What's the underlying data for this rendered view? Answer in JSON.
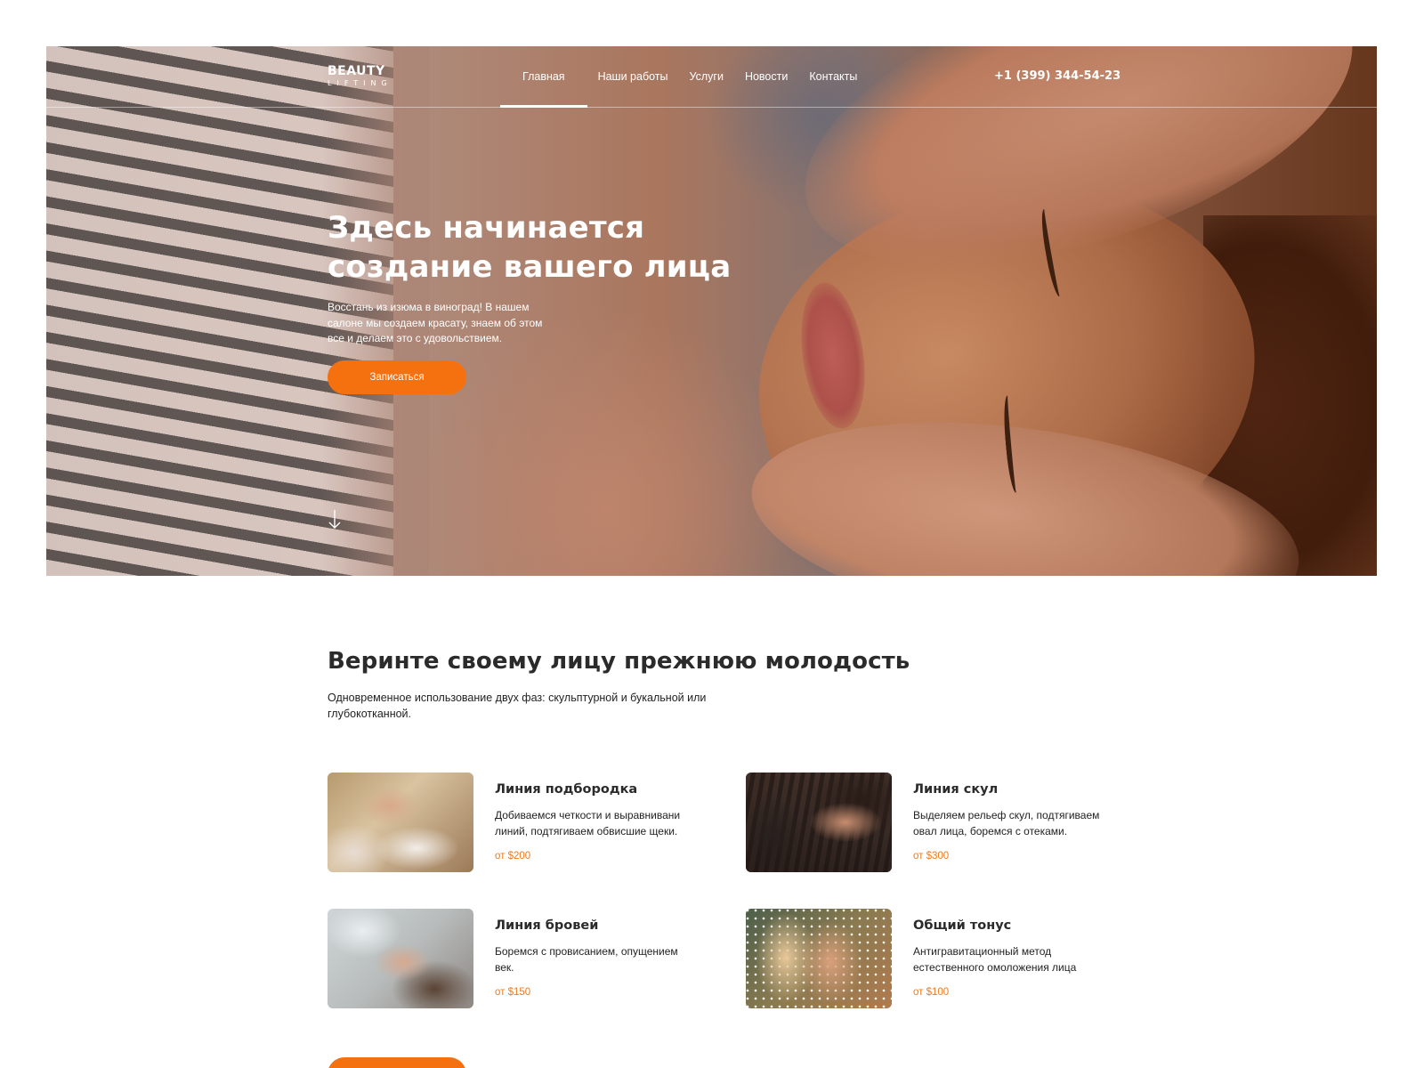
{
  "brand": {
    "name": "BEAUTY",
    "sub": "LIFTING"
  },
  "nav": {
    "items": [
      {
        "label": "Главная",
        "active": true
      },
      {
        "label": "Наши работы",
        "active": false
      },
      {
        "label": "Услуги",
        "active": false
      },
      {
        "label": "Новости",
        "active": false
      },
      {
        "label": "Контакты",
        "active": false
      }
    ],
    "phone": "+1 (399) 344-54-23"
  },
  "hero": {
    "title_line1": "Здесь начинается",
    "title_line2": "создание вашего лица",
    "text": "Восстань из изюма в виноград! В нашем салоне мы создаем красату, знаем об этом все и делаем это с удовольствием.",
    "cta_label": "Записаться",
    "scroll_icon": "arrow-down-icon"
  },
  "section": {
    "title": "Веринте своему лицу прежнюю молодость",
    "text": "Одновременное использование двух фаз: скульптурной и букальной или глубокотканной.",
    "cards": [
      {
        "title": "Линия подбородка",
        "desc": "Добиваемся четкости и выравнивани линий, подтягиваем обвисшие щеки.",
        "price": "от $200"
      },
      {
        "title": "Линия скул",
        "desc": "Выделяем рельеф скул, подтягиваем овал лица, боремся с отеками.",
        "price": "от $300"
      },
      {
        "title": "Линия бровей",
        "desc": "Боремся с провисанием, опущением век.",
        "price": "от $150"
      },
      {
        "title": "Общий тонус",
        "desc": "Антигравитационный метод естественного омоложения лица",
        "price": "от $100"
      }
    ]
  },
  "colors": {
    "accent": "#f5700f",
    "price": "#f07a1c",
    "text": "#2b2b2b"
  }
}
